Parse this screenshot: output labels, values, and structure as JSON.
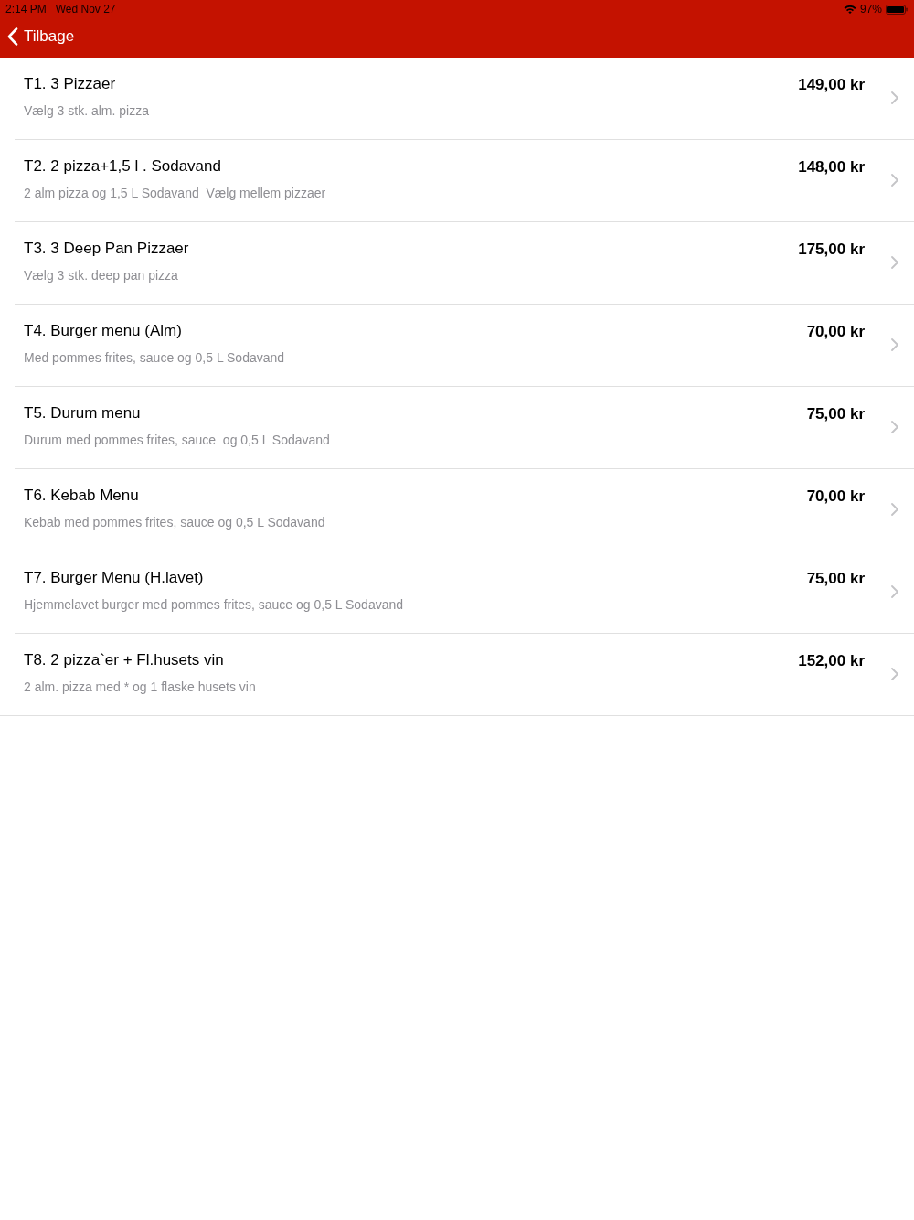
{
  "status_bar": {
    "time": "2:14 PM",
    "date": "Wed Nov 27",
    "battery": "97%"
  },
  "nav_bar": {
    "back_button": "Tilbage"
  },
  "menu_items": [
    {
      "title": "T1. 3 Pizzaer",
      "description": "Vælg 3 stk. alm. pizza",
      "price": "149,00 kr"
    },
    {
      "title": "T2. 2 pizza+1,5 l . Sodavand",
      "description": "2 alm pizza og 1,5 L Sodavand  Vælg mellem pizzaer",
      "price": "148,00 kr"
    },
    {
      "title": "T3. 3 Deep Pan Pizzaer",
      "description": "Vælg 3 stk. deep pan pizza",
      "price": "175,00 kr"
    },
    {
      "title": "T4. Burger menu (Alm)",
      "description": "Med pommes frites, sauce og 0,5 L Sodavand",
      "price": "70,00 kr"
    },
    {
      "title": "T5. Durum menu",
      "description": "Durum med pommes frites, sauce  og 0,5 L Sodavand",
      "price": "75,00 kr"
    },
    {
      "title": "T6. Kebab Menu",
      "description": "Kebab med pommes frites, sauce og 0,5 L Sodavand",
      "price": "70,00 kr"
    },
    {
      "title": "T7. Burger Menu (H.lavet)",
      "description": "Hjemmelavet burger med pommes frites, sauce og 0,5 L Sodavand",
      "price": "75,00 kr"
    },
    {
      "title": "T8. 2 pizza`er + Fl.husets vin",
      "description": "2 alm. pizza med * og 1 flaske husets vin",
      "price": "152,00 kr"
    }
  ]
}
